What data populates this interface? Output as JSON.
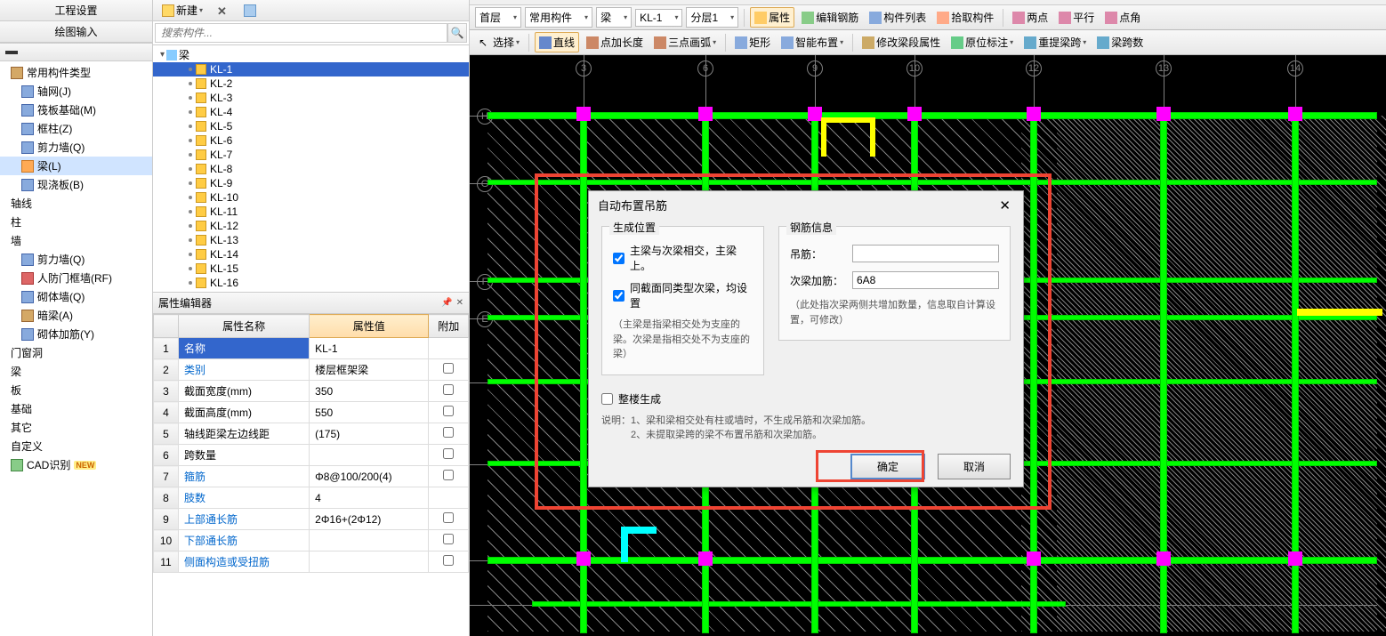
{
  "left_panel": {
    "tabs": [
      "工程设置",
      "绘图输入"
    ],
    "nav": [
      {
        "label": "常用构件类型",
        "sub": true
      },
      {
        "label": "轴网(J)"
      },
      {
        "label": "筏板基础(M)"
      },
      {
        "label": "框柱(Z)"
      },
      {
        "label": "剪力墙(Q)"
      },
      {
        "label": "梁(L)",
        "selected": true
      },
      {
        "label": "现浇板(B)"
      },
      {
        "label": "轴线",
        "group": true
      },
      {
        "label": "柱",
        "group": true
      },
      {
        "label": "墙",
        "group": true
      },
      {
        "label": "剪力墙(Q)"
      },
      {
        "label": "人防门框墙(RF)"
      },
      {
        "label": "砌体墙(Q)"
      },
      {
        "label": "暗梁(A)"
      },
      {
        "label": "砌体加筋(Y)"
      },
      {
        "label": "门窗洞",
        "group": true
      },
      {
        "label": "梁",
        "group": true
      },
      {
        "label": "板",
        "group": true
      },
      {
        "label": "基础",
        "group": true
      },
      {
        "label": "其它",
        "group": true
      },
      {
        "label": "自定义",
        "group": true
      },
      {
        "label": "CAD识别",
        "group": true,
        "new": true
      }
    ]
  },
  "mid_panel": {
    "toolbar": {
      "new_label": "新建",
      "delete_char": "✕"
    },
    "search_placeholder": "搜索构件...",
    "tree_root": "梁",
    "leaves": [
      "KL-1",
      "KL-2",
      "KL-3",
      "KL-4",
      "KL-5",
      "KL-6",
      "KL-7",
      "KL-8",
      "KL-9",
      "KL-10",
      "KL-11",
      "KL-12",
      "KL-13",
      "KL-14",
      "KL-15",
      "KL-16"
    ],
    "selected_leaf": "KL-1",
    "prop_header": "属性编辑器",
    "prop_cols": {
      "name": "属性名称",
      "value": "属性值",
      "extra": "附加"
    },
    "props": [
      {
        "n": "1",
        "name": "名称",
        "value": "KL-1",
        "link": false,
        "sel": true
      },
      {
        "n": "2",
        "name": "类别",
        "value": "楼层框架梁",
        "link": true
      },
      {
        "n": "3",
        "name": "截面宽度(mm)",
        "value": "350",
        "link": false
      },
      {
        "n": "4",
        "name": "截面高度(mm)",
        "value": "550",
        "link": false
      },
      {
        "n": "5",
        "name": "轴线距梁左边线距",
        "value": "(175)",
        "link": false
      },
      {
        "n": "6",
        "name": "跨数量",
        "value": "",
        "link": false
      },
      {
        "n": "7",
        "name": "箍筋",
        "value": "Φ8@100/200(4)",
        "link": true
      },
      {
        "n": "8",
        "name": "肢数",
        "value": "4",
        "link": true
      },
      {
        "n": "9",
        "name": "上部通长筋",
        "value": "2Φ16+(2Φ12)",
        "link": true
      },
      {
        "n": "10",
        "name": "下部通长筋",
        "value": "",
        "link": true
      },
      {
        "n": "11",
        "name": "侧面构造或受扭筋",
        "value": "",
        "link": true
      }
    ]
  },
  "top_toolbar1": {
    "floor": "首层",
    "category": "常用构件",
    "component": "梁",
    "item": "KL-1",
    "layer": "分层1",
    "btns": [
      "属性",
      "编辑钢筋",
      "构件列表",
      "拾取构件",
      "两点",
      "平行",
      "点角"
    ]
  },
  "top_toolbar2": {
    "select": "选择",
    "btns": [
      "直线",
      "点加长度",
      "三点画弧"
    ],
    "rect": "矩形",
    "smart": "智能布置",
    "actions": [
      "修改梁段属性",
      "原位标注",
      "重提梁跨",
      "梁跨数"
    ]
  },
  "grid": {
    "top_labels": [
      "3",
      "6",
      "9",
      "10",
      "12",
      "13",
      "14"
    ],
    "left_labels": [
      "H",
      "G",
      "F",
      "E"
    ]
  },
  "dialog": {
    "title": "自动布置吊筋",
    "group1_title": "生成位置",
    "chk1": "主梁与次梁相交，主梁上。",
    "chk2": "同截面同类型次梁，均设置",
    "note1": "（主梁是指梁相交处为支座的梁。次梁是指相交处不为支座的梁）",
    "group2_title": "钢筋信息",
    "field1_label": "吊筋：",
    "field1_value": "",
    "field2_label": "次梁加筋：",
    "field2_value": "6A8",
    "note2": "（此处指次梁两侧共增加数量，信息取自计算设置，可修改）",
    "chk3": "整楼生成",
    "explain": "说明：1、梁和梁相交处有柱或墙时，不生成吊筋和次梁加筋。\n　　　2、未提取梁跨的梁不布置吊筋和次梁加筋。",
    "ok": "确定",
    "cancel": "取消"
  }
}
